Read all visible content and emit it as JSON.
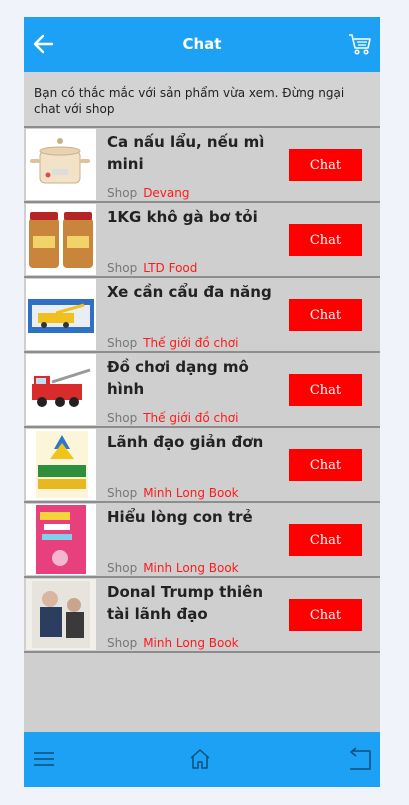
{
  "header": {
    "title": "Chat",
    "back_icon": "arrow-left-icon",
    "cart_icon": "cart-icon"
  },
  "notice": "Bạn có thắc mắc với sản phẩm vừa xem. Đừng ngại chat với shop",
  "shop_label": "Shop",
  "chat_label": "Chat",
  "items": [
    {
      "name": "Ca nấu lẩu, nếu mì mini",
      "shop": "Devang",
      "thumb": "cooker-image"
    },
    {
      "name": "1KG khô gà bơ tỏi",
      "shop": "LTD Food",
      "thumb": "dried-chicken-jars-image"
    },
    {
      "name": "Xe cần cẩu đa năng",
      "shop": "Thế giới đồ chơi",
      "thumb": "crane-toy-box-image"
    },
    {
      "name": "Đồ chơi dạng mô hình",
      "shop": "Thế giới đồ chơi",
      "thumb": "fire-truck-toy-image"
    },
    {
      "name": "Lãnh đạo giản đơn",
      "shop": "Minh Long Book",
      "thumb": "book-cover-leadership-image"
    },
    {
      "name": "Hiểu lòng con trẻ",
      "shop": "Minh Long Book",
      "thumb": "book-cover-pink-image"
    },
    {
      "name": "Donal Trump thiên tài lãnh đạo",
      "shop": "Minh Long Book",
      "thumb": "book-cover-trump-image"
    }
  ],
  "footer": {
    "menu_icon": "hamburger-menu-icon",
    "home_icon": "home-icon",
    "return_icon": "return-icon"
  },
  "colors": {
    "primary": "#1da1f5",
    "chat_button": "#ff0000",
    "shop_name": "#ff1a1a",
    "background": "#cfcfcf"
  }
}
